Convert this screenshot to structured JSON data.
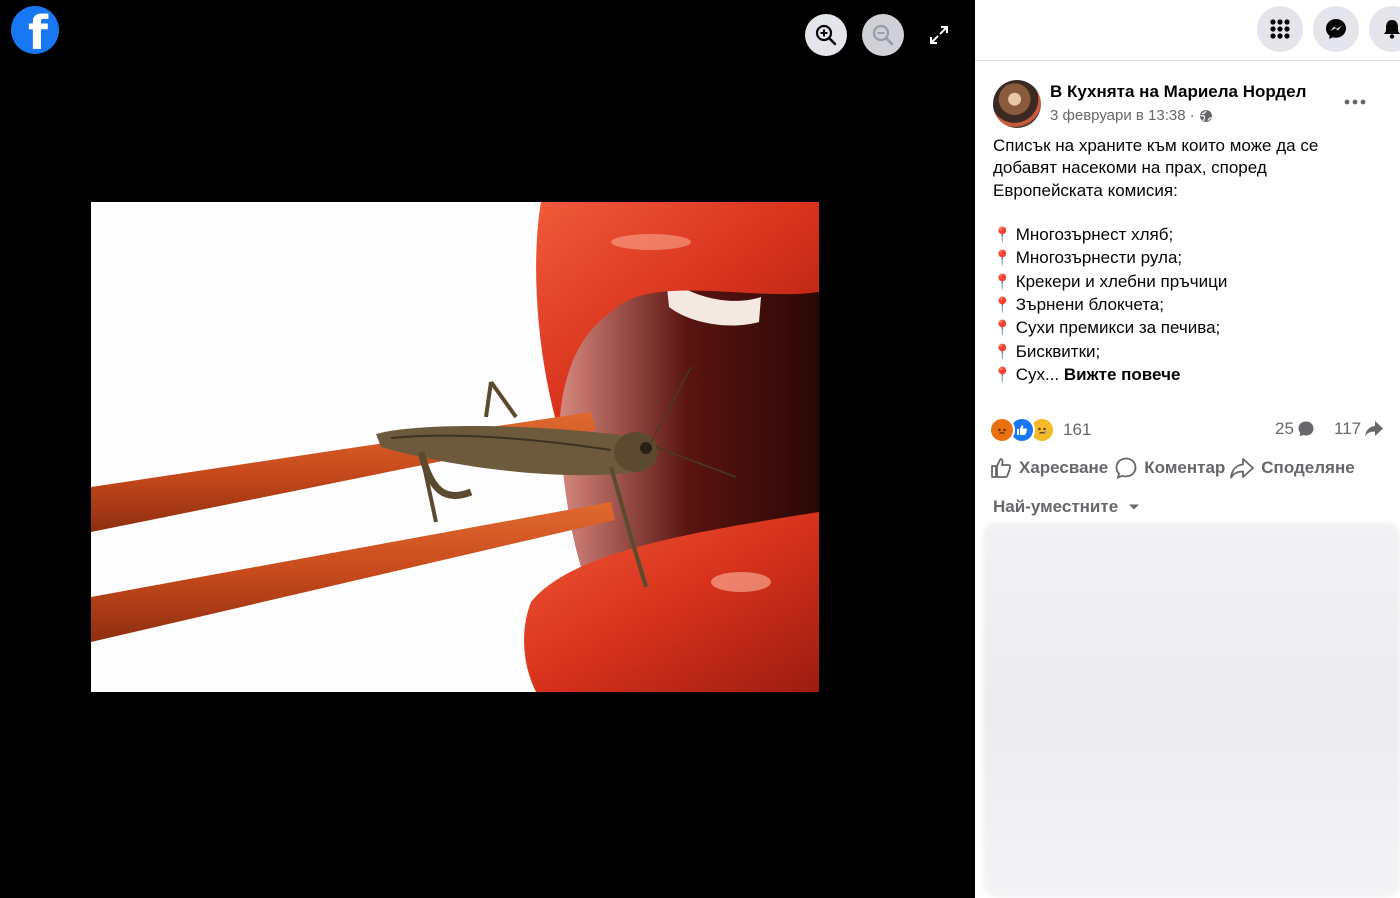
{
  "viewer": {
    "logo_letter": "f",
    "zoom_in_icon": "zoom-in-icon",
    "zoom_out_icon": "zoom-out-icon",
    "fullscreen_icon": "fullscreen-icon"
  },
  "topbar": {
    "menu_icon": "grid-menu-icon",
    "messenger_icon": "messenger-icon",
    "bell_icon": "bell-icon"
  },
  "post": {
    "author": "В Кухнята на Мариела Нордел",
    "date": "3 февруари в 13:38",
    "separator": "·",
    "intro_lines": [
      "Списък на храните към които може да се",
      "добавят насекоми на прах, според",
      "Европейската комисия:"
    ],
    "list_items": [
      "Многозърнест хляб;",
      "Многозърнести рула;",
      "Крекери и хлебни пръчици",
      "Зърнени блокчета;",
      "Сухи премикси за печива;",
      "Бисквитки;"
    ],
    "truncated_item": "Сух...",
    "see_more": "Вижте повече"
  },
  "stats": {
    "reactions": "161",
    "comments": "25",
    "shares": "117"
  },
  "actions": {
    "like": "Харесване",
    "comment": "Коментар",
    "share": "Споделяне"
  },
  "comments": {
    "sort_label": "Най-уместните"
  },
  "colors": {
    "brand": "#1877f2",
    "secondary_text": "#65676b",
    "lip_red": "#d8321c",
    "chopstick": "#c84a1c"
  }
}
